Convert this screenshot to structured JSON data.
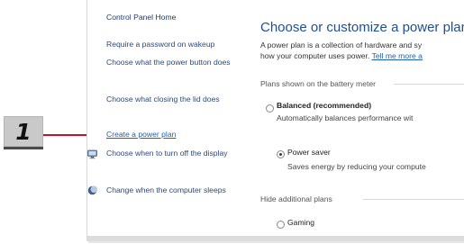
{
  "callout": {
    "number": "1"
  },
  "sidebar": {
    "home": "Control Panel Home",
    "links": [
      {
        "label": "Require a password on wakeup"
      },
      {
        "label": "Choose what the power button does"
      },
      {
        "label": "Choose what closing the lid does"
      },
      {
        "label": "Create a power plan"
      },
      {
        "label": "Choose when to turn off the display",
        "icon": "display-icon"
      },
      {
        "label": "Change when the computer sleeps",
        "icon": "sleep-moon-icon"
      }
    ]
  },
  "main": {
    "title": "Choose or customize a power plan",
    "desc_line1": "A power plan is a collection of hardware and sy",
    "desc_line2_prefix": "how your computer uses power. ",
    "learn_more": "Tell me more a",
    "battery_group": "Plans shown on the battery meter",
    "plans": [
      {
        "name": "Balanced (recommended)",
        "desc": "Automatically balances performance wit",
        "checked": false
      },
      {
        "name": "Power saver",
        "desc": "Saves energy by reducing your compute",
        "checked": true
      }
    ],
    "hidden_group": "Hide additional plans",
    "hidden_plans": [
      {
        "name": "Gaming",
        "checked": false
      }
    ]
  }
}
